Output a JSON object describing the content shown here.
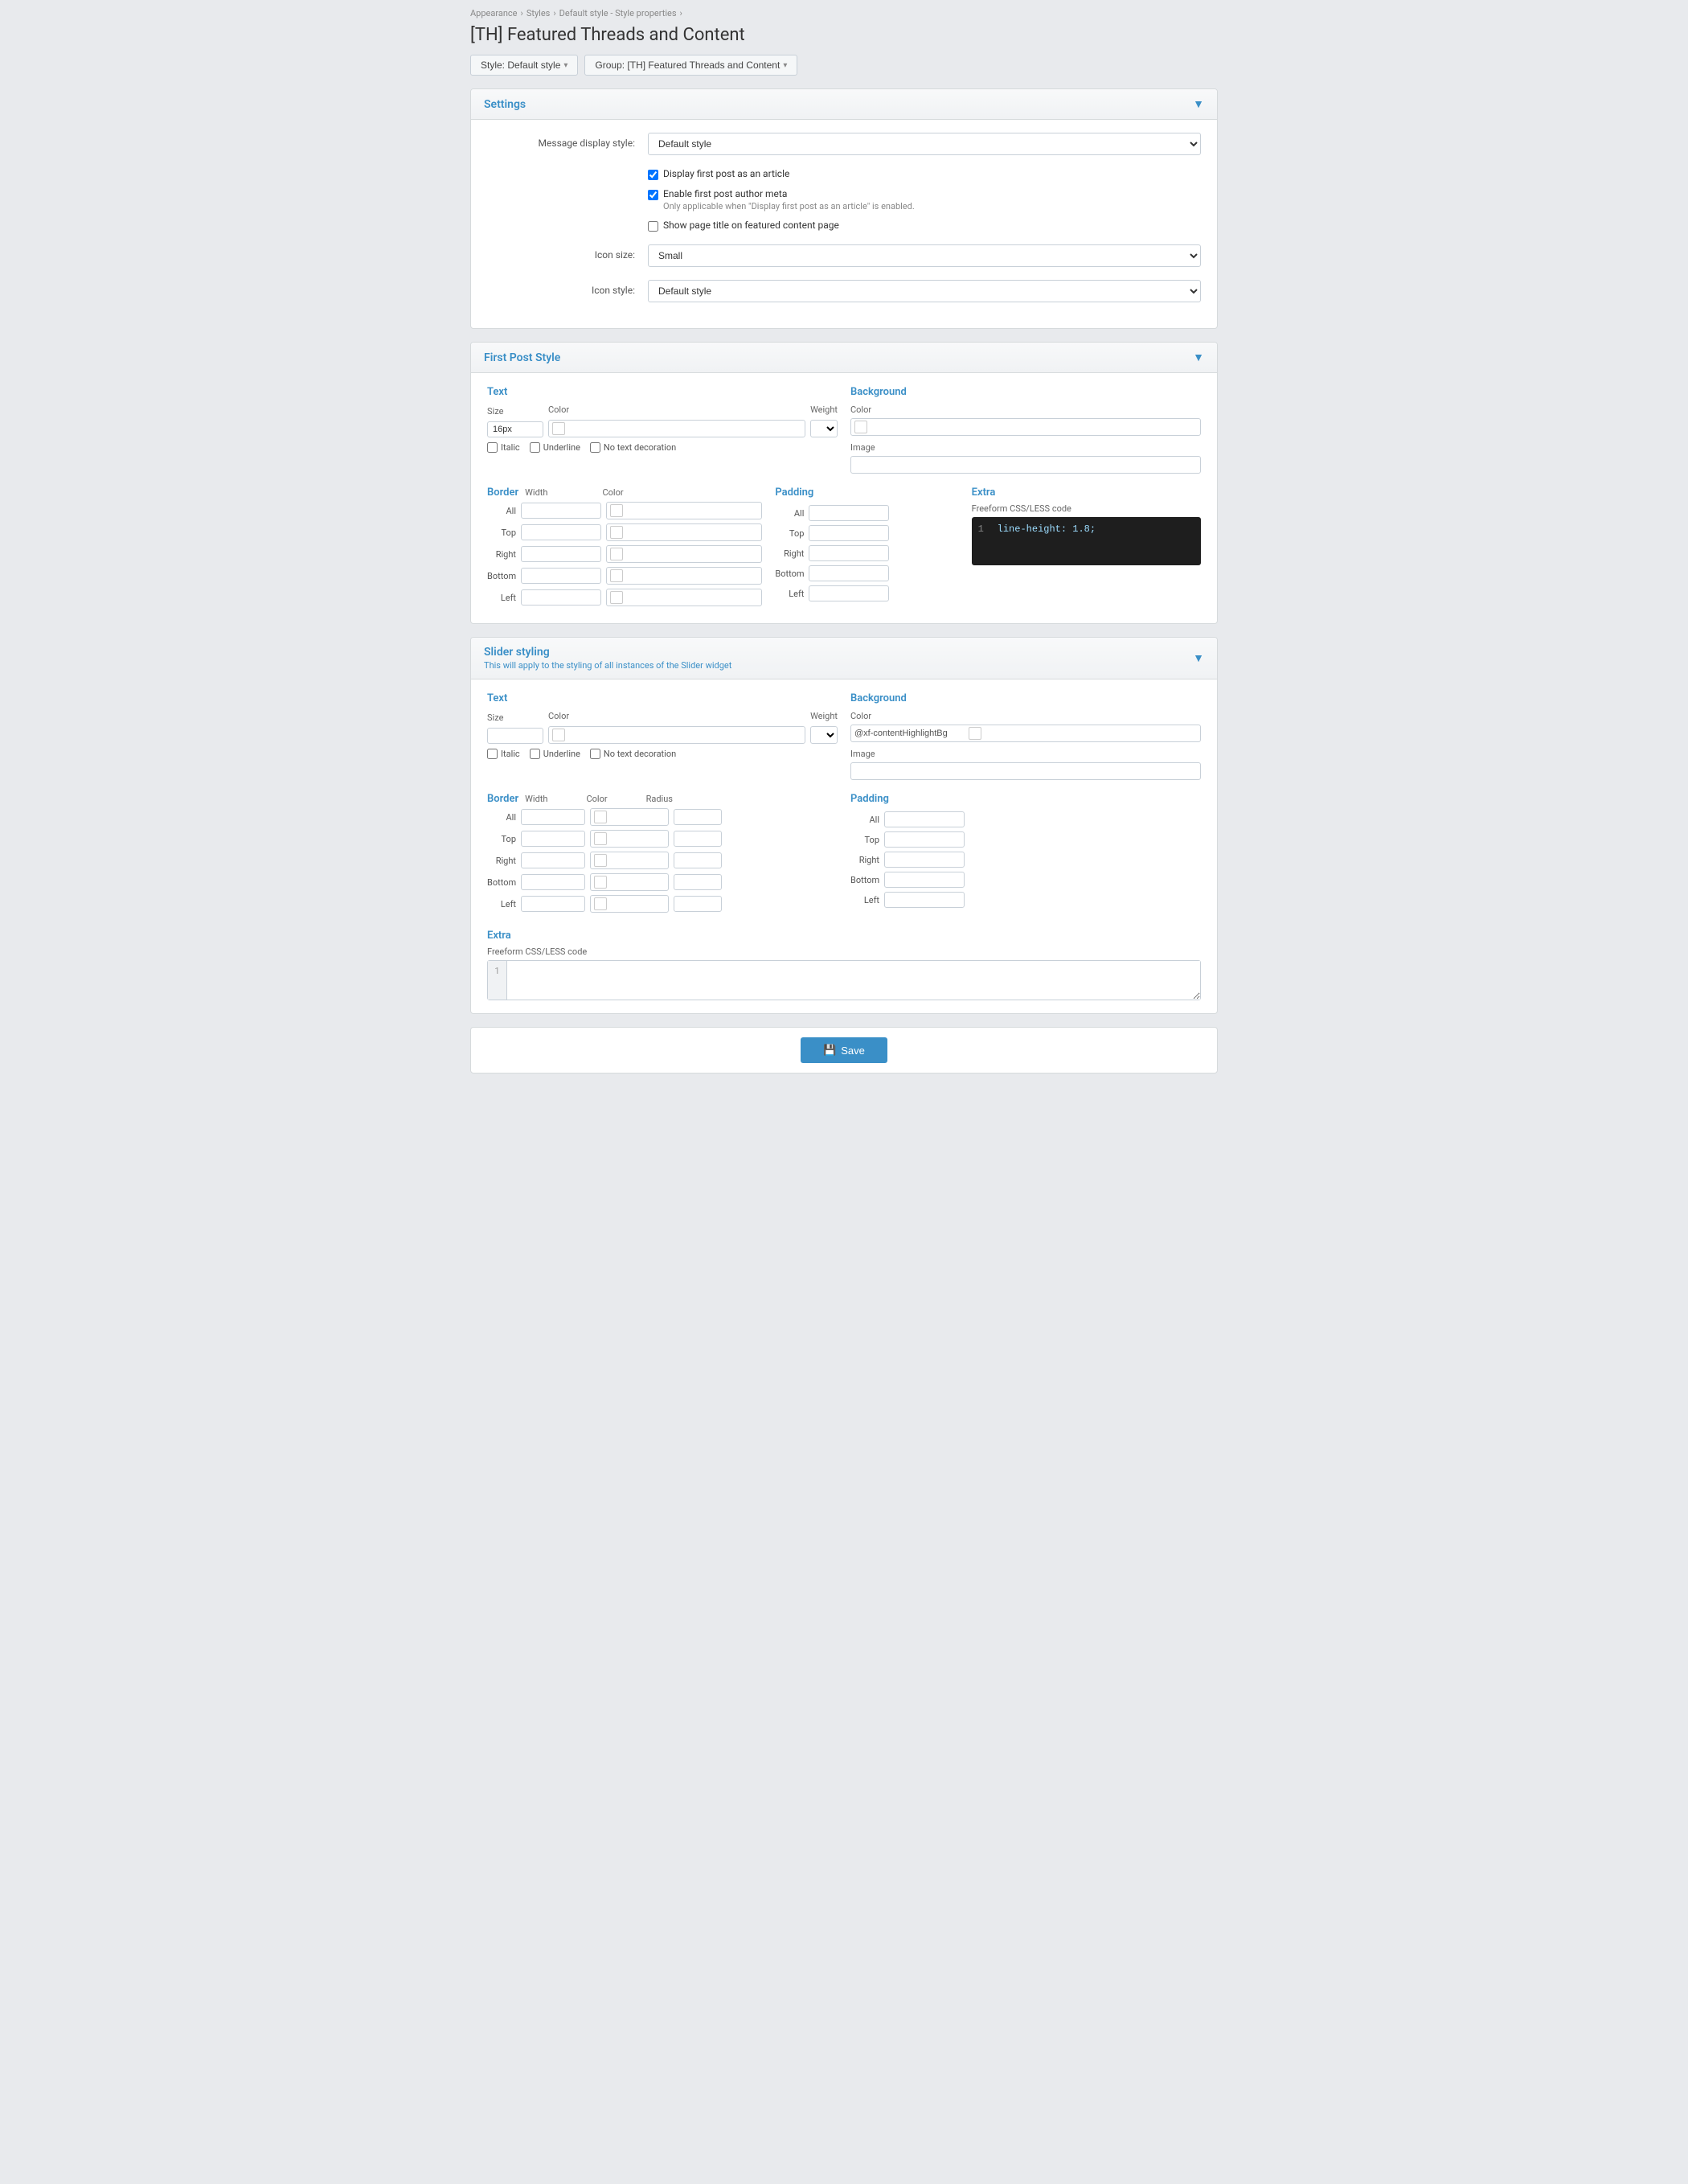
{
  "breadcrumb": {
    "items": [
      "Appearance",
      "Styles",
      "Default style - Style properties"
    ]
  },
  "page": {
    "title": "[TH] Featured Threads and Content"
  },
  "toolbar": {
    "style_btn": "Style: Default style",
    "group_btn": "Group: [TH] Featured Threads and Content"
  },
  "sections": {
    "settings": {
      "title": "Settings",
      "message_display_label": "Message display style:",
      "message_display_value": "Default style",
      "checkbox1_label": "Display first post as an article",
      "checkbox2_label": "Enable first post author meta",
      "checkbox2_hint": "Only applicable when \"Display first post as an article\" is enabled.",
      "checkbox3_label": "Show page title on featured content page",
      "icon_size_label": "Icon size:",
      "icon_size_value": "Small",
      "icon_style_label": "Icon style:",
      "icon_style_value": "Default style"
    },
    "first_post_style": {
      "title": "First Post Style",
      "text_section": "Text",
      "size_label": "Size",
      "color_label": "Color",
      "weight_label": "Weight",
      "size_value": "16px",
      "italic_label": "Italic",
      "underline_label": "Underline",
      "no_text_decoration_label": "No text decoration",
      "background_section": "Background",
      "bg_color_label": "Color",
      "bg_image_label": "Image",
      "border_section": "Border",
      "border_width_label": "Width",
      "border_color_label": "Color",
      "border_rows": [
        "All",
        "Top",
        "Right",
        "Bottom",
        "Left"
      ],
      "padding_section": "Padding",
      "padding_rows": [
        "All",
        "Top",
        "Right",
        "Bottom",
        "Left"
      ],
      "extra_section": "Extra",
      "extra_label": "Freeform CSS/LESS code",
      "extra_code": "line-height: 1.8;"
    },
    "slider_styling": {
      "title": "Slider styling",
      "subtitle": "This will apply to the styling of all instances of the Slider widget",
      "text_section": "Text",
      "size_label": "Size",
      "color_label": "Color",
      "weight_label": "Weight",
      "italic_label": "Italic",
      "underline_label": "Underline",
      "no_text_decoration_label": "No text decoration",
      "background_section": "Background",
      "bg_color_label": "Color",
      "bg_color_value": "@xf-contentHighlightBg",
      "bg_image_label": "Image",
      "border_section": "Border",
      "border_width_label": "Width",
      "border_color_label": "Color",
      "border_radius_label": "Radius",
      "border_rows": [
        "All",
        "Top",
        "Right",
        "Bottom",
        "Left"
      ],
      "padding_section": "Padding",
      "padding_rows": [
        "All",
        "Top",
        "Right",
        "Bottom",
        "Left"
      ],
      "extra_section": "Extra",
      "extra_label": "Freeform CSS/LESS code"
    }
  },
  "save_button": "Save",
  "icons": {
    "chevron_down": "▼",
    "caret": "▾",
    "save": "💾",
    "checkbox_checked": "✓"
  }
}
